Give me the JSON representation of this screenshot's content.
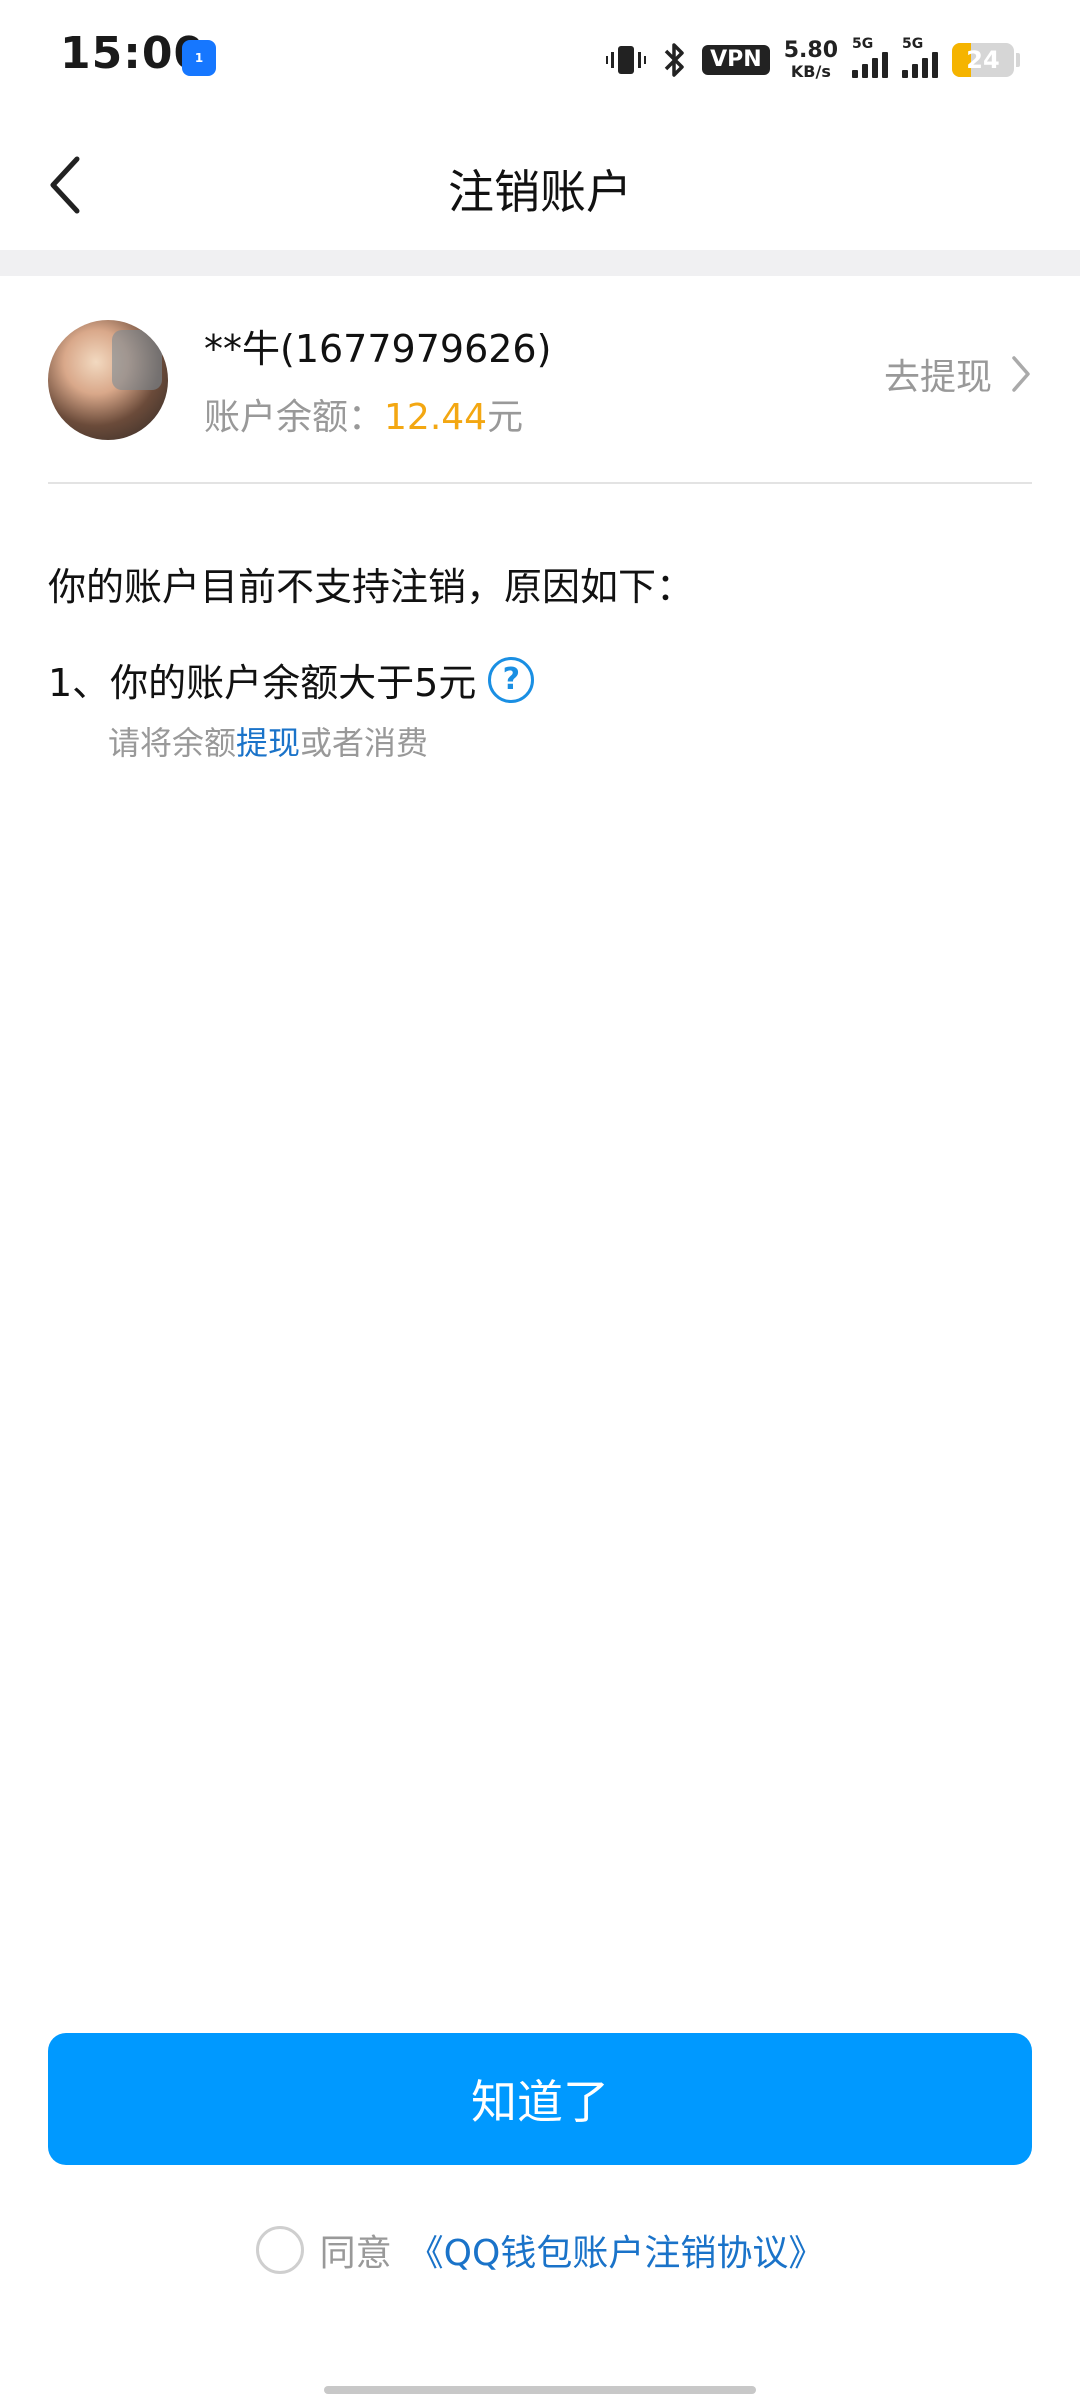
{
  "status_bar": {
    "time": "15:00",
    "hotspot_badge": "1",
    "vpn": "VPN",
    "net_speed_value": "5.80",
    "net_speed_unit": "KB/s",
    "sim1_label": "5G",
    "sim2_label": "5G",
    "battery_level": "24",
    "battery_color": "#f5b400"
  },
  "nav": {
    "title": "注销账户"
  },
  "account": {
    "name": "**牛(1677979626)",
    "balance_label": "账户余额：",
    "balance_amount": "12.44",
    "balance_unit": "元",
    "withdraw_label": "去提现"
  },
  "reasons": {
    "title": "你的账户目前不支持注销，原因如下：",
    "items": [
      {
        "text": "1、你的账户余额大于5元",
        "sub_prefix": "请将余额",
        "sub_link": "提现",
        "sub_suffix": "或者消费"
      }
    ]
  },
  "actions": {
    "ok_label": "知道了",
    "agree_label": "同意",
    "agreement_link": "《QQ钱包账户注销协议》"
  },
  "colors": {
    "primary_button": "#0099ff",
    "link": "#1a73c9",
    "amount": "#f3a712"
  }
}
